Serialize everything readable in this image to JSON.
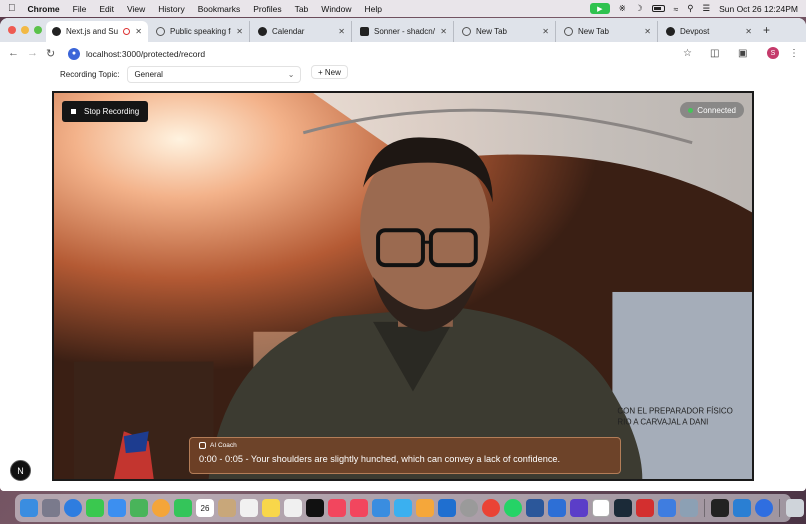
{
  "menubar": {
    "app": "Chrome",
    "items": [
      "File",
      "Edit",
      "View",
      "History",
      "Bookmarks",
      "Profiles",
      "Tab",
      "Window",
      "Help"
    ],
    "datetime": "Sun Oct 26  12:24PM"
  },
  "tabs": [
    {
      "label": "Next.js and Sup",
      "active": true,
      "icon": "nextjs-icon"
    },
    {
      "label": "Public speaking fe",
      "active": false,
      "icon": "globe-icon"
    },
    {
      "label": "Calendar",
      "active": false,
      "icon": "calendar-icon"
    },
    {
      "label": "Sonner - shadcn/ui",
      "active": false,
      "icon": "shadcn-icon"
    },
    {
      "label": "New Tab",
      "active": false,
      "icon": "chrome-icon"
    },
    {
      "label": "New Tab",
      "active": false,
      "icon": "chrome-icon"
    },
    {
      "label": "Devpost",
      "active": false,
      "icon": "devpost-icon"
    }
  ],
  "address_bar": {
    "url": "localhost:3000/protected/record"
  },
  "profile_initial": "S",
  "recording": {
    "topic_label": "Recording Topic:",
    "topic_value": "General",
    "new_label": "+ New",
    "stop_label": "Stop Recording",
    "status": "Connected"
  },
  "coach": {
    "title": "AI Coach",
    "message": "0:00 - 0:05 - Your shoulders are slightly hunched, which can convey a lack of confidence."
  },
  "video_overlay_text": {
    "line1": "CON EL PREPARADOR FÍSICO",
    "line2": "RIO A CARVAJAL A DANI"
  },
  "n_badge": "N",
  "dock": {
    "calendar_day": "26"
  },
  "colors": {
    "status_dot": "#46c35a",
    "coach_bg": "#784628",
    "accent": "#3b65d8"
  }
}
